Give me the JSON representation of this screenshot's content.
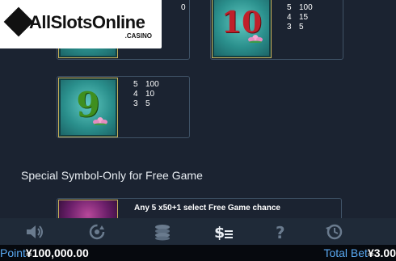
{
  "logo": {
    "text": "AllSlotsOnline",
    "sub": ".CASINO"
  },
  "symbols": [
    {
      "glyph": "10",
      "pays": [
        {
          "count": "5",
          "value": "100"
        },
        {
          "count": "4",
          "value": "15"
        },
        {
          "count": "3",
          "value": "5"
        }
      ]
    },
    {
      "glyph": "9",
      "pays": [
        {
          "count": "5",
          "value": "100"
        },
        {
          "count": "4",
          "value": "10"
        },
        {
          "count": "3",
          "value": "5"
        }
      ]
    }
  ],
  "partial_top_left_pay": "0",
  "special": {
    "title": "Special Symbol-Only for Free Game",
    "rule": "Any 5  x50+1 select Free Game chance"
  },
  "footer": {
    "point_label": "Point",
    "point_value": "¥100,000.00",
    "bet_label": "Total Bet",
    "bet_value": "¥3.00"
  },
  "colors": {
    "bg": "#1b2331",
    "accent": "#5aa9f2",
    "tile_green": "#2a8f8c",
    "numeral_red": "#c0202a",
    "numeral_green": "#3f8f1e"
  },
  "toolbar": {
    "icons": [
      "speaker-icon",
      "autoplay-icon",
      "coins-icon",
      "paytable-icon",
      "help-icon",
      "history-icon"
    ]
  }
}
